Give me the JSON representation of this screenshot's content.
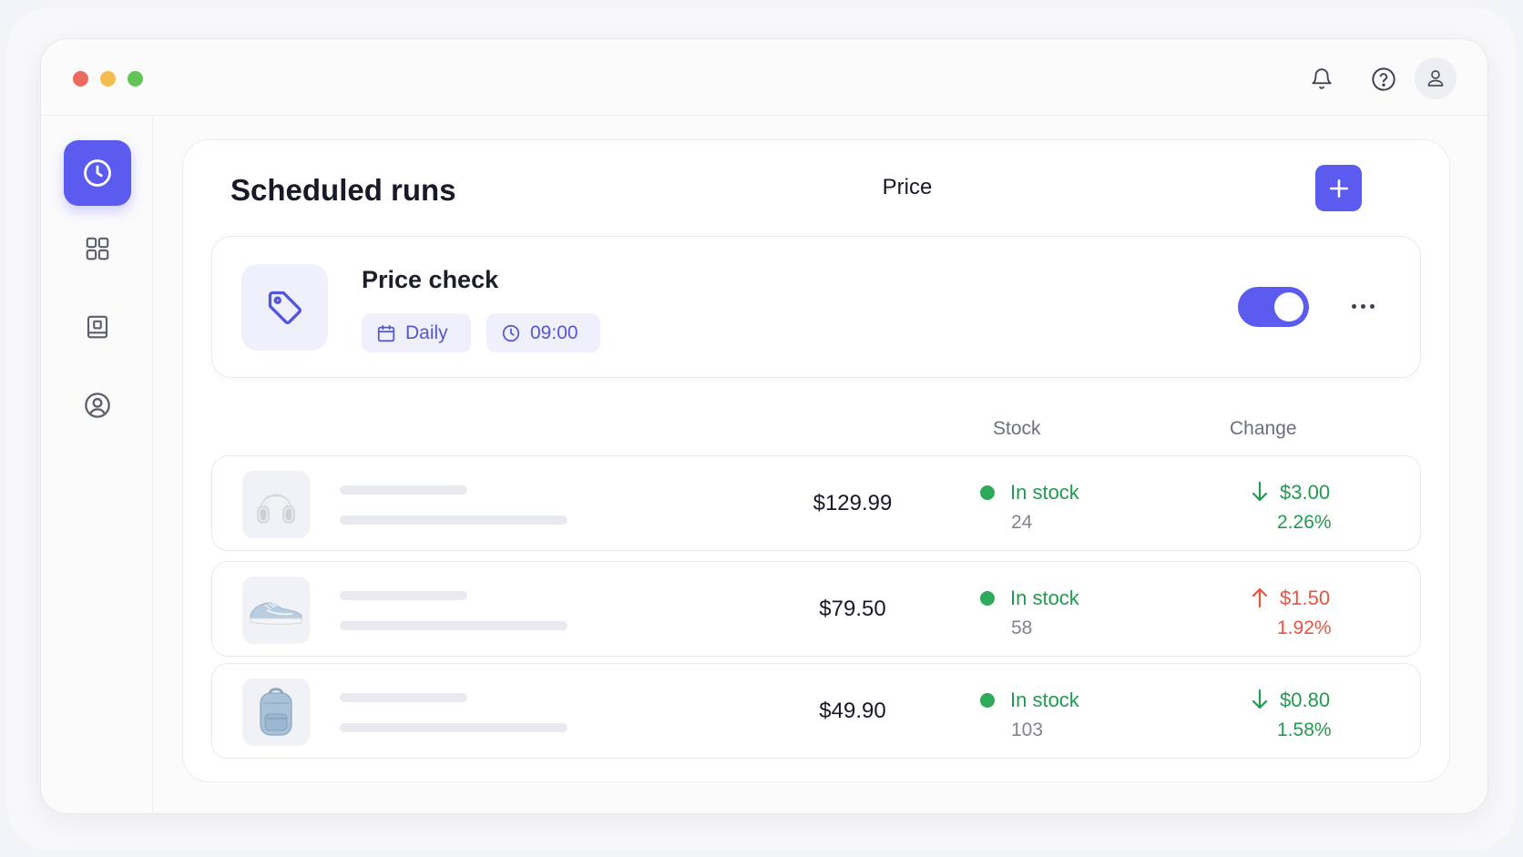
{
  "window": {
    "controls": [
      "close",
      "minimize",
      "maximize"
    ],
    "header_icons": [
      "bell-icon",
      "help-icon",
      "user-icon"
    ]
  },
  "sidebar": {
    "items": [
      {
        "icon": "clock-icon",
        "active": true
      },
      {
        "icon": "grid-icon",
        "active": false
      },
      {
        "icon": "book-icon",
        "active": false
      },
      {
        "icon": "user-circle-icon",
        "active": false
      }
    ]
  },
  "page": {
    "title": "Scheduled runs"
  },
  "schedule": {
    "name": "Price check",
    "frequency": "Daily",
    "time": "09:00",
    "enabled": true
  },
  "table": {
    "columns": {
      "price": "Price",
      "stock": "Stock",
      "change": "Change"
    },
    "rows": [
      {
        "product": "headphones",
        "price": "$129.99",
        "stock_status": "In stock",
        "stock_count": "24",
        "direction": "down",
        "change_amount": "$3.00",
        "change_pct": "2.26%"
      },
      {
        "product": "sneaker",
        "price": "$79.50",
        "stock_status": "In stock",
        "stock_count": "58",
        "direction": "up",
        "change_amount": "$1.50",
        "change_pct": "1.92%"
      },
      {
        "product": "backpack",
        "price": "$49.90",
        "stock_status": "In stock",
        "stock_count": "103",
        "direction": "down",
        "change_amount": "$0.80",
        "change_pct": "1.58%"
      }
    ]
  },
  "colors": {
    "accent": "#5b5bf0",
    "positive": "#229a4f",
    "negative": "#e8543f",
    "chip_bg": "#f0f0fd"
  }
}
